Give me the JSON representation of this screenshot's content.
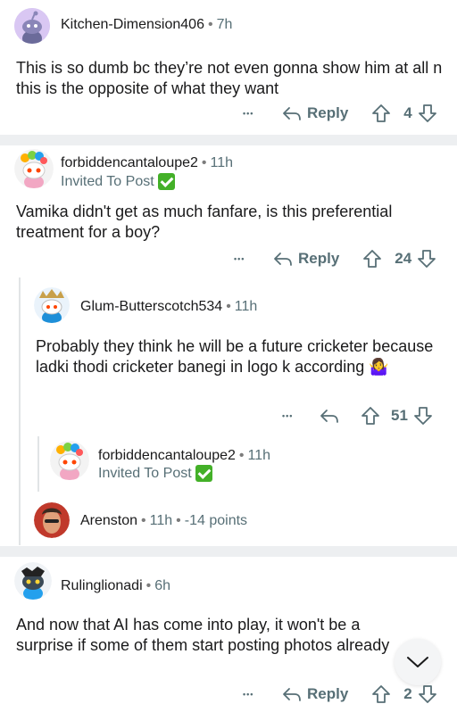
{
  "comments": [
    {
      "username": "Kitchen-Dimension406",
      "age": "7h",
      "body": "This is so dumb bc they’re not even gonna show him at all n this is the opposite of what they want",
      "reply_label": "Reply",
      "votes": "4"
    },
    {
      "username": "forbiddencantaloupe2",
      "age": "11h",
      "flair": "Invited To Post",
      "body": "Vamika didn't get as much fanfare, is this preferential treatment for a boy?",
      "reply_label": "Reply",
      "votes": "24"
    },
    {
      "username": "Glum-Butterscotch534",
      "age": "11h",
      "body": "Probably they think he will be a future cricketer because ladki thodi cricketer banegi in logo k according",
      "emoji": "🤷‍♀️",
      "votes": "51"
    },
    {
      "username": "forbiddencantaloupe2",
      "age": "11h",
      "flair": "Invited To Post"
    },
    {
      "username": "Arenston",
      "age": "11h",
      "points": "-14 points"
    },
    {
      "username": "Rulinglionadi",
      "age": "6h",
      "body": "And now that AI has come into play, it won't be a surprise if some of them start posting photos already",
      "reply_label": "Reply",
      "votes": "2"
    }
  ],
  "separator": "•",
  "more_label": "•••",
  "colors": {
    "divider": "#edeff1",
    "meta": "#576f76",
    "verified": "#43b028"
  },
  "icons": [
    "reply-arrow-icon",
    "upvote-icon",
    "downvote-icon",
    "more-icon",
    "chevron-down-icon",
    "checkmark-icon"
  ]
}
